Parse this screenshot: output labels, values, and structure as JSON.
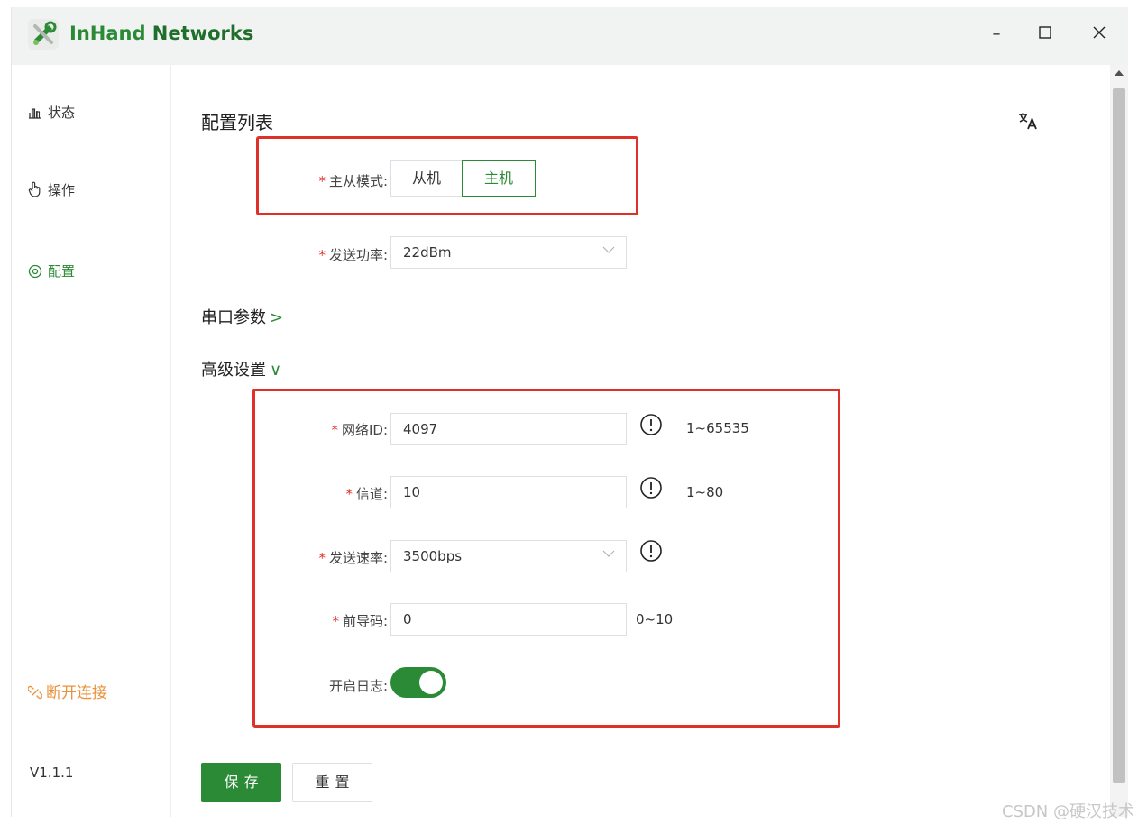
{
  "window": {
    "title_first": "InHand",
    "title_rest": " Networks",
    "controls": {
      "minimize": "–",
      "maximize": "☐",
      "close": "✕"
    }
  },
  "sidebar": {
    "items": [
      {
        "label": "状态",
        "icon": "bar-chart-icon"
      },
      {
        "label": "操作",
        "icon": "pointer-hand-icon"
      },
      {
        "label": "配置",
        "icon": "target-icon"
      }
    ],
    "disconnect": "断开连接",
    "version": "V1.1.1"
  },
  "main": {
    "title": "配置列表",
    "translate_icon": "translate-icon",
    "mode": {
      "label": "主从模式:",
      "options": [
        "从机",
        "主机"
      ],
      "selected": "主机"
    },
    "power": {
      "label": "发送功率:",
      "value": "22dBm"
    },
    "serial_section": {
      "label": "串口参数",
      "arrow": ">"
    },
    "advanced_section": {
      "label": "高级设置",
      "arrow": "∨"
    },
    "network_id": {
      "label": "网络ID:",
      "value": "4097",
      "hint": "1~65535"
    },
    "channel": {
      "label": "信道:",
      "value": "10",
      "hint": "1~80"
    },
    "rate": {
      "label": "发送速率:",
      "value": "3500bps"
    },
    "preamble": {
      "label": "前导码:",
      "value": "0",
      "hint": "0~10"
    },
    "log": {
      "label": "开启日志:",
      "enabled": true
    },
    "save": "保存",
    "reset": "重置",
    "required_mark": "*"
  },
  "watermark": "CSDN @硬汉技术",
  "colors": {
    "accent": "#2a8a35",
    "required": "#e0302a",
    "warning": "#e8923a",
    "highlight_box": "#e0302a"
  }
}
